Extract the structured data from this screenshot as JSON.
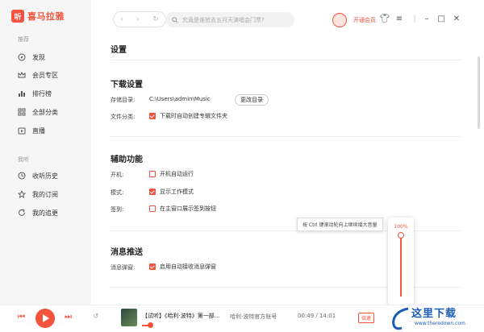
{
  "app": {
    "logo_glyph": "听",
    "name": "喜马拉雅"
  },
  "sidebar": {
    "section_recommend": "推荐",
    "items_recommend": [
      {
        "label": "发现",
        "icon": "compass-icon"
      },
      {
        "label": "会员专区",
        "icon": "vip-crown-icon"
      },
      {
        "label": "排行榜",
        "icon": "ranking-icon"
      },
      {
        "label": "全部分类",
        "icon": "grid-icon"
      },
      {
        "label": "直播",
        "icon": "live-icon"
      }
    ],
    "section_mine": "我听",
    "items_mine": [
      {
        "label": "收听历史",
        "icon": "clock-icon"
      },
      {
        "label": "我的订阅",
        "icon": "star-icon"
      },
      {
        "label": "我的追更",
        "icon": "refresh-icon"
      }
    ]
  },
  "header": {
    "search_placeholder": "究竟是谁抢去五月天演唱会门票?",
    "vip_label": "开通会员"
  },
  "settings": {
    "title": "设置",
    "download": {
      "title": "下载设置",
      "dir_label": "存储目录:",
      "dir_value": "C:\\Users\\admin\\Music",
      "change_button": "更改目录",
      "category_label": "文件分类:",
      "category_option": "下载时自动创建专辑文件夹",
      "category_checked": true
    },
    "assist": {
      "title": "辅助功能",
      "startup_label": "开机:",
      "startup_option": "开机自动运行",
      "startup_checked": false,
      "mode_label": "模式:",
      "mode_option": "显示工作模式",
      "mode_checked": true,
      "signin_label": "签到:",
      "signin_option": "在主窗口展示签到按钮",
      "signin_checked": false
    },
    "notify": {
      "title": "消息推送",
      "popup_label": "消息弹窗:",
      "popup_option": "启用自动接收消息弹窗",
      "popup_checked": true
    }
  },
  "tooltip": "按 Ctrl 键滚动轮向上继续增大音量",
  "volume": {
    "label": "100%",
    "level": 1.0
  },
  "player": {
    "track_title": "【试听】《哈利·波特》第一部...",
    "author": "哈利·波特官方账号",
    "time": "00:49 / 14:01",
    "speed_label": "倍速"
  },
  "watermark": {
    "text": "这里下载",
    "url": "www.theredown.com"
  },
  "colors": {
    "accent": "#f5533d",
    "watermark": "#1b5db5"
  }
}
